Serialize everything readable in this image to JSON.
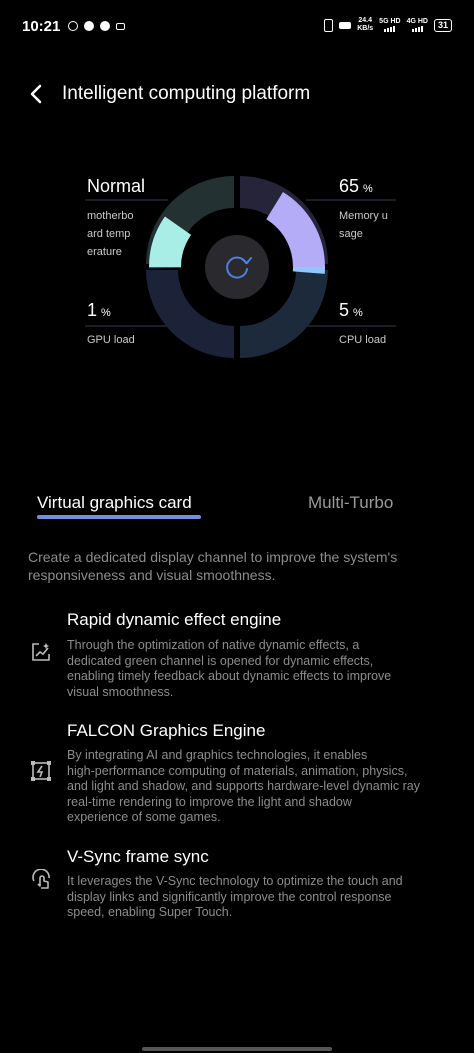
{
  "status": {
    "time": "10:21",
    "net_speed_value": "24.4",
    "net_speed_unit": "KB/s",
    "sim1": "5G HD",
    "sim2": "4G HD",
    "battery": "31"
  },
  "header": {
    "title": "Intelligent computing platform"
  },
  "gauges": {
    "temperature": {
      "value": "Normal",
      "label_lines": [
        "motherbo",
        "ard temp",
        "erature"
      ]
    },
    "memory": {
      "value": "65",
      "unit": "%",
      "label_lines": [
        "Memory u",
        "sage"
      ]
    },
    "gpu": {
      "value": "1",
      "unit": "%",
      "label": "GPU load"
    },
    "cpu": {
      "value": "5",
      "unit": "%",
      "label": "CPU load"
    }
  },
  "colors": {
    "temperature_fill": "#a9eee6",
    "memory_fill": "#b5acf7",
    "cpu_fill": "#8fc7ff",
    "tab_accent": "#6f8fe0"
  },
  "tabs": [
    {
      "label": "Virtual graphics card",
      "active": true
    },
    {
      "label": "Multi-Turbo",
      "active": false
    }
  ],
  "description": "Create a dedicated display channel to improve the system's responsiveness and visual smoothness.",
  "features": [
    {
      "icon": "dynamic-effect-icon",
      "title": "Rapid dynamic effect engine",
      "lines": [
        "Through the optimization of native dynamic effects, a",
        "dedicated green channel is opened for dynamic effects,",
        "enabling timely feedback about dynamic effects to improve",
        "visual smoothness."
      ]
    },
    {
      "icon": "graphics-engine-icon",
      "title": "FALCON Graphics Engine",
      "lines": [
        "By integrating AI and graphics technologies, it enables",
        "high-performance computing of materials, animation, physics,",
        "and light and shadow, and supports hardware-level dynamic ray",
        "real-time rendering to improve the light and shadow",
        "experience of some games."
      ]
    },
    {
      "icon": "touch-sync-icon",
      "title": "V-Sync frame sync",
      "lines": [
        "It leverages the V-Sync technology to optimize the touch and",
        "display links and significantly improve the control response",
        "speed, enabling Super Touch."
      ]
    }
  ]
}
